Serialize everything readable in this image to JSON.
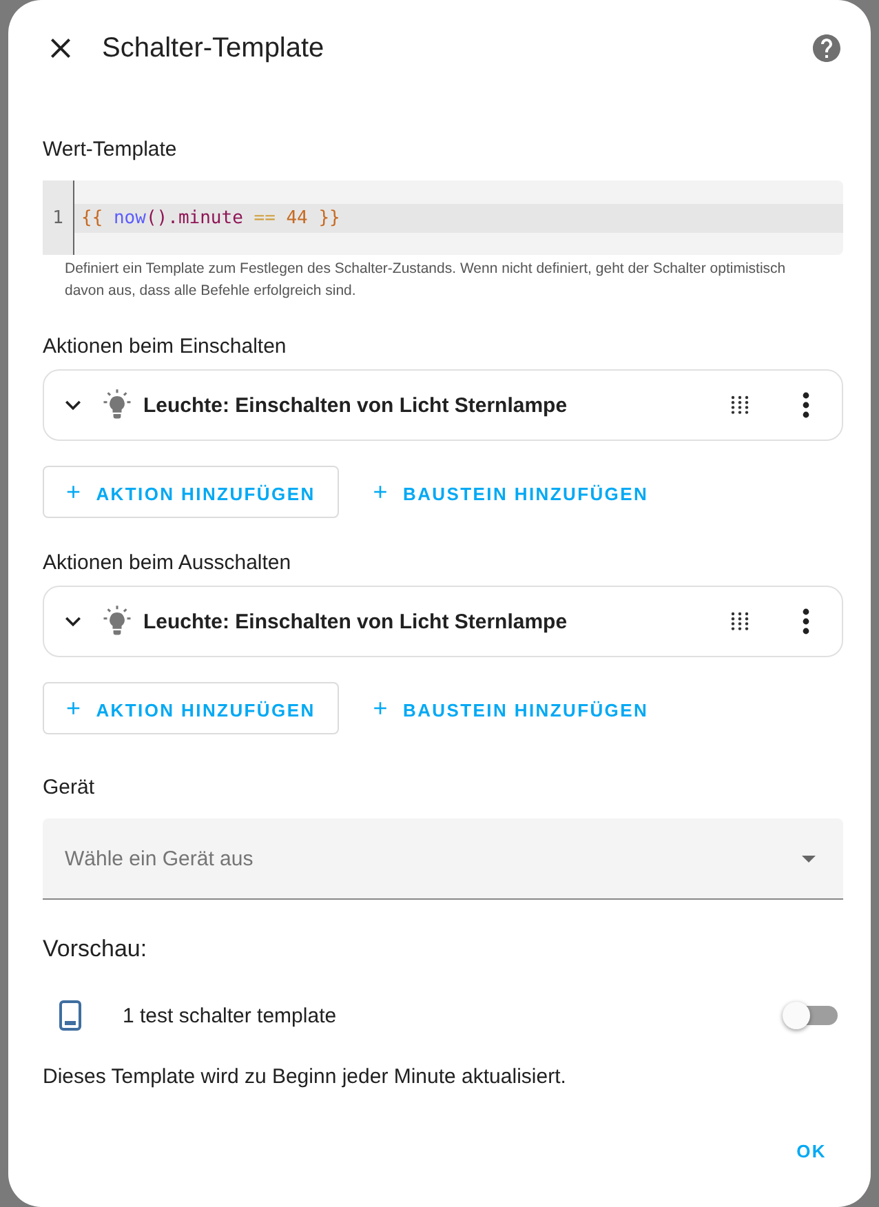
{
  "dialog": {
    "title": "Schalter-Template"
  },
  "value_template": {
    "label": "Wert-Template",
    "line_number": "1",
    "tokens": [
      {
        "text": "{{ ",
        "kind": "bracket"
      },
      {
        "text": "now",
        "kind": "function"
      },
      {
        "text": "().minute",
        "kind": "property"
      },
      {
        "text": " == ",
        "kind": "operator"
      },
      {
        "text": "44",
        "kind": "number"
      },
      {
        "text": " }}",
        "kind": "bracket"
      }
    ],
    "helper": "Definiert ein Template zum Festlegen des Schalter-Zustands. Wenn nicht definiert, geht der Schalter optimistisch davon aus, dass alle Befehle erfolgreich sind."
  },
  "action_sections": [
    {
      "label": "Aktionen beim Einschalten",
      "actions": [
        {
          "text": "Leuchte: Einschalten von Licht Sternlampe",
          "expanded": false
        }
      ],
      "buttons": [
        {
          "label": "AKTION HINZUFÜGEN",
          "kind": "outlined",
          "icon": "+"
        },
        {
          "label": "BAUSTEIN HINZUFÜGEN",
          "kind": "text",
          "icon": "+"
        }
      ]
    },
    {
      "label": "Aktionen beim Ausschalten",
      "actions": [
        {
          "text": "Leuchte: Einschalten von Licht Sternlampe",
          "expanded": false
        }
      ],
      "buttons": [
        {
          "label": "AKTION HINZUFÜGEN",
          "kind": "outlined",
          "icon": "+"
        },
        {
          "label": "BAUSTEIN HINZUFÜGEN",
          "kind": "text",
          "icon": "+"
        }
      ]
    }
  ],
  "device": {
    "label": "Gerät",
    "placeholder": "Wähle ein Gerät aus"
  },
  "preview": {
    "heading": "Vorschau:",
    "entity": {
      "name": "1 test schalter template",
      "on": false
    },
    "note": "Dieses Template wird zu Beginn jeder Minute aktualisiert."
  },
  "footer": {
    "buttons": [
      "OK"
    ]
  }
}
